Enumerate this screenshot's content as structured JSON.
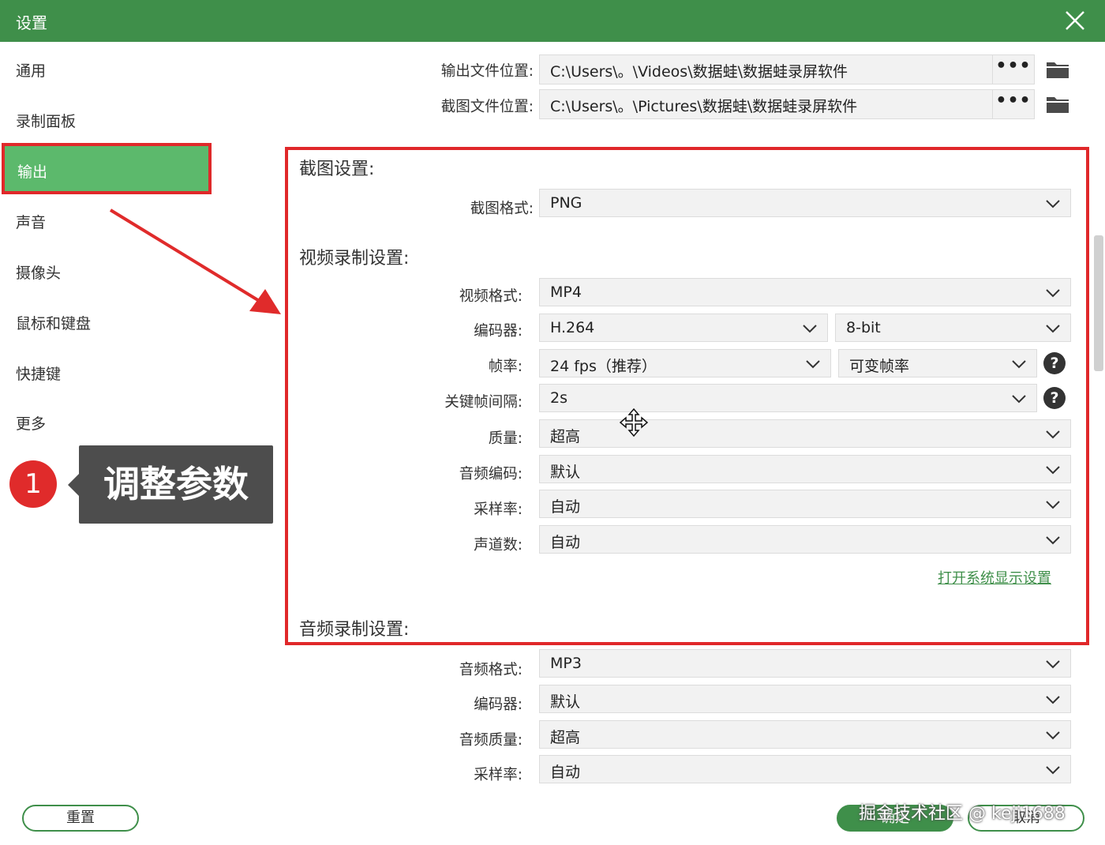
{
  "window": {
    "title": "设置"
  },
  "sidebar": {
    "items": [
      {
        "label": "通用"
      },
      {
        "label": "录制面板"
      },
      {
        "label": "输出"
      },
      {
        "label": "声音"
      },
      {
        "label": "摄像头"
      },
      {
        "label": "鼠标和键盘"
      },
      {
        "label": "快捷键"
      },
      {
        "label": "更多"
      }
    ],
    "active_index": 2
  },
  "annotation": {
    "number": "1",
    "text": "调整参数"
  },
  "output_paths": {
    "output_label": "输出文件位置:",
    "output_value": "C:\\Users\\。\\Videos\\数据蛙\\数据蛙录屏软件",
    "screenshot_label": "截图文件位置:",
    "screenshot_value": "C:\\Users\\。\\Pictures\\数据蛙\\数据蛙录屏软件",
    "more_label": "•••"
  },
  "screenshot_settings": {
    "title": "截图设置:",
    "format_label": "截图格式:",
    "format_value": "PNG"
  },
  "video_settings": {
    "title": "视频录制设置:",
    "format_label": "视频格式:",
    "format_value": "MP4",
    "encoder_label": "编码器:",
    "encoder_value": "H.264",
    "bitdepth_value": "8-bit",
    "framerate_label": "帧率:",
    "framerate_value": "24 fps（推荐）",
    "framerate_mode_value": "可变帧率",
    "keyframe_label": "关键帧间隔:",
    "keyframe_value": "2s",
    "quality_label": "质量:",
    "quality_value": "超高",
    "audio_codec_label": "音频编码:",
    "audio_codec_value": "默认",
    "sample_rate_label": "采样率:",
    "sample_rate_value": "自动",
    "channels_label": "声道数:",
    "channels_value": "自动",
    "display_link": "打开系统显示设置"
  },
  "audio_settings": {
    "title": "音频录制设置:",
    "format_label": "音频格式:",
    "format_value": "MP3",
    "encoder_label": "编码器:",
    "encoder_value": "默认",
    "quality_label": "音频质量:",
    "quality_value": "超高",
    "sample_rate_label": "采样率:",
    "sample_rate_value": "自动"
  },
  "footer": {
    "reset_label": "重置",
    "ok_label": "确定",
    "cancel_label": "取消"
  },
  "watermark": "掘金技术社区 @ keji1688",
  "help_symbol": "?",
  "colors": {
    "titlebar": "#3f8f4a",
    "active_item": "#5cb96c",
    "highlight_border": "#e0282a",
    "annotation_box": "#4d4d4d"
  }
}
